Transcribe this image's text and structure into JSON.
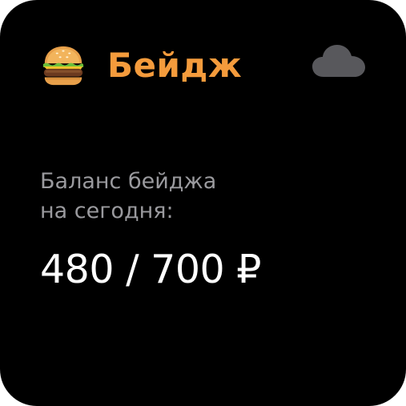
{
  "widget": {
    "title": "Бейдж",
    "icons": {
      "leading": "hamburger-emoji-icon",
      "trailing": "cloud-icon"
    },
    "label_line1": "Баланс бейджа",
    "label_line2": "на сегодня:",
    "balance": "480 / 700 ₽"
  },
  "colors": {
    "background": "#000000",
    "title": "#f49b3c",
    "label": "#9a9a9e",
    "value": "#ffffff",
    "cloud": "#58585c"
  }
}
